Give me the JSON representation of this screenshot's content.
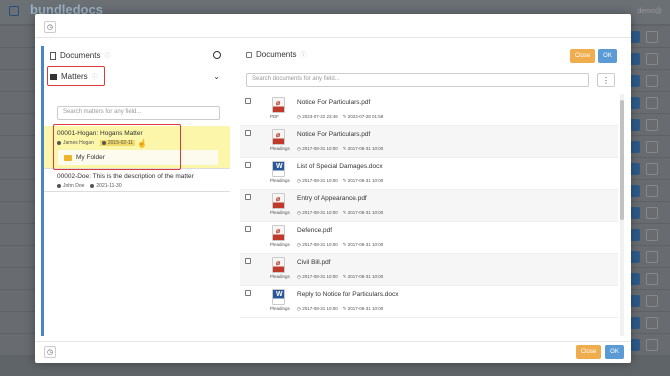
{
  "background": {
    "logo": "bundledocs",
    "user": "demo@"
  },
  "modal": {
    "left": {
      "documents_label": "Documents",
      "matters_label": "Matters",
      "matter_search_placeholder": "Search matters for any field...",
      "matters": [
        {
          "title": "00001-Hogan: Hogans Matter",
          "owner": "James Hogan",
          "date": "2015-02-11",
          "selected": true
        },
        {
          "title": "00002-Doe: This is the description of the matter",
          "owner": "John Doe",
          "date": "2021-11-30",
          "selected": false
        }
      ],
      "folder_label": "My Folder"
    },
    "right": {
      "documents_label": "Documents",
      "close_label": "Close",
      "ok_label": "OK",
      "doc_search_placeholder": "Search documents for any field...",
      "kebab": "⋮",
      "documents": [
        {
          "name": "Notice For Particulars.pdf",
          "type": "pdf",
          "tag": "PDF",
          "created": "2023-07-22 23:46",
          "modified": "2023-07-28 01:58"
        },
        {
          "name": "Notice For Particulars.pdf",
          "type": "pdf",
          "tag": "Pleadings",
          "created": "2017-08-31 10:00",
          "modified": "2017-08-31 10:00"
        },
        {
          "name": "List of Special Damages.docx",
          "type": "word",
          "tag": "Pleadings",
          "created": "2017-08-31 10:00",
          "modified": "2017-08-31 10:00"
        },
        {
          "name": "Entry of Appearance.pdf",
          "type": "pdf",
          "tag": "Pleadings",
          "created": "2017-08-31 10:00",
          "modified": "2017-08-31 10:00"
        },
        {
          "name": "Defence.pdf",
          "type": "pdf",
          "tag": "Pleadings",
          "created": "2017-08-31 10:00",
          "modified": "2017-08-31 10:00"
        },
        {
          "name": "Civil Bill.pdf",
          "type": "pdf",
          "tag": "Pleadings",
          "created": "2017-08-31 10:00",
          "modified": "2017-08-31 10:00"
        },
        {
          "name": "Reply to Notice for Particulars.docx",
          "type": "word",
          "tag": "Pleadings",
          "created": "2017-08-31 10:00",
          "modified": "2017-08-31 10:00"
        }
      ]
    },
    "footer": {
      "close_label": "Close",
      "ok_label": "OK"
    }
  },
  "colors": {
    "accent_blue": "#4a86c5",
    "close_orange": "#f0ad4e",
    "ok_blue": "#5b9bd5",
    "highlight_yellow": "#fbf6a9",
    "annotation_red": "#d93a3a"
  }
}
